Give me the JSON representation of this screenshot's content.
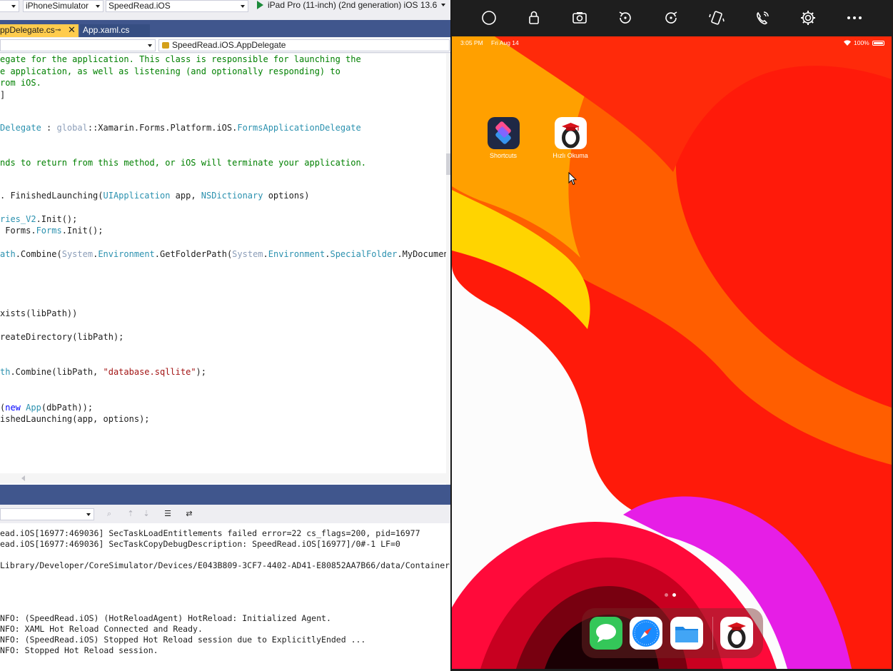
{
  "vs": {
    "toolbar": {
      "config_dropdown": "",
      "platform_dropdown": "iPhoneSimulator",
      "project_dropdown": "SpeedRead.iOS",
      "run_target": "iPad Pro (11-inch) (2nd generation) iOS 13.6"
    },
    "tabs": {
      "active": "ppDelegate.cs",
      "pin_glyph": "⊸",
      "close_glyph": "✕",
      "second": "App.xaml.cs"
    },
    "navbar": {
      "left": "",
      "right": "SpeedRead.iOS.AppDelegate"
    },
    "code": [
      "egate for the application. This class is responsible for launching the",
      "e application, as well as listening (and optionally responding) to",
      "rom iOS.",
      "]",
      "Delegate : global::Xamarin.Forms.Platform.iOS.FormsApplicationDelegate",
      "nds to return from this method, or iOS will terminate your application.",
      ". FinishedLaunching(UIApplication app, NSDictionary options)",
      "ries_V2.Init();",
      " Forms.Forms.Init();",
      "ath.Combine(System.Environment.GetFolderPath(System.Environment.SpecialFolder.MyDocuments),",
      "xists(libPath))",
      "reateDirectory(libPath);",
      "th.Combine(libPath, \"database.sqllite\");",
      "(new App(dbPath));",
      "ishedLaunching(app, options);"
    ],
    "output": [
      "ead.iOS[16977:469036] SecTaskLoadEntitlements failed error=22 cs_flags=200, pid=16977",
      "ead.iOS[16977:469036] SecTaskCopyDebugDescription: SpeedRead.iOS[16977]/0#-1 LF=0",
      "Library/Developer/CoreSimulator/Devices/E043B809-3CF7-4402-AD41-E80852AA7B66/data/Container",
      "NFO: (SpeedRead.iOS) (HotReloadAgent) HotReload: Initialized Agent.",
      "NFO: XAML Hot Reload Connected and Ready.",
      "NFO: (SpeedRead.iOS) Stopped Hot Reload session due to ExplicitlyEnded ...",
      "NFO: Stopped Hot Reload session."
    ],
    "output_source": ""
  },
  "sim": {
    "toolbar_icons": [
      "home-circle-icon",
      "lock-icon",
      "screenshot-camera-icon",
      "rotate-left-icon",
      "rotate-right-icon",
      "shake-icon",
      "siri-icon",
      "settings-gear-icon",
      "more-icon"
    ],
    "status": {
      "time": "3:05 PM",
      "date": "Fri Aug 14",
      "battery": "100%"
    },
    "apps": [
      {
        "label": "Shortcuts"
      },
      {
        "label": "Hızlı Okuma"
      }
    ],
    "dock_apps": [
      "messages-icon",
      "safari-icon",
      "files-icon",
      "hizli-okuma-icon"
    ],
    "colors": {
      "wall_red": "#ff1a0a",
      "wall_orange": "#ff5e00",
      "wall_yellow": "#ffd400",
      "wall_magenta": "#e61ee6"
    }
  }
}
